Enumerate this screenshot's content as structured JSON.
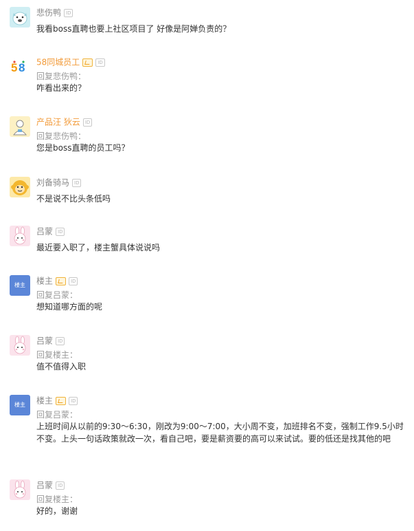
{
  "comments": [
    {
      "avatar": "bulldog-avatar",
      "name": "悲伤鸭",
      "name_color": "gray",
      "badges": [
        "ID"
      ],
      "reply_to": "",
      "text": "我看boss直聘也要上社区项目了 好像是阿婵负责的？"
    },
    {
      "avatar": "58-logo-avatar",
      "name": "58同城员工",
      "name_color": "orange",
      "badges": [
        "VIP",
        "ID"
      ],
      "reply_to": "回复悲伤鸭：",
      "text": "咋看出来的？"
    },
    {
      "avatar": "person-avatar",
      "name": "产品汪 狄云",
      "name_color": "orange",
      "badges": [
        "ID"
      ],
      "reply_to": "回复悲伤鸭：",
      "text": "您是boss直聘的员工吗？"
    },
    {
      "avatar": "monkey-avatar",
      "name": "刘备骑马",
      "name_color": "gray",
      "badges": [
        "ID"
      ],
      "reply_to": "",
      "text": "不是说不比头条低吗"
    },
    {
      "avatar": "rabbit-avatar",
      "name": "吕蒙",
      "name_color": "gray",
      "badges": [
        "ID"
      ],
      "reply_to": "",
      "text": "最近要入职了，楼主蟹具体说说吗"
    },
    {
      "avatar": "owner-avatar",
      "avatar_text": "楼主",
      "name": "楼主",
      "name_color": "gray",
      "badges": [
        "VIP",
        "ID"
      ],
      "reply_to": "回复吕蒙：",
      "text": "想知道哪方面的呢"
    },
    {
      "avatar": "rabbit-avatar",
      "name": "吕蒙",
      "name_color": "gray",
      "badges": [
        "ID"
      ],
      "reply_to": "回复楼主：",
      "text": "值不值得入职"
    },
    {
      "avatar": "owner-avatar",
      "avatar_text": "楼主",
      "name": "楼主",
      "name_color": "gray",
      "badges": [
        "VIP",
        "ID"
      ],
      "reply_to": "回复吕蒙：",
      "text": "上班时间从以前的9:30～6:30，刚改为9:00～7:00，大小周不变，加班排名不变，强制工作9.5小时不变。上头一句话政策就改一次，看自己吧，要是薪资要的高可以来试试。要的低还是找其他的吧"
    },
    {
      "avatar": "rabbit-avatar",
      "name": "吕蒙",
      "name_color": "gray",
      "badges": [
        "ID"
      ],
      "reply_to": "回复楼主：",
      "text": "好的，谢谢"
    }
  ],
  "colors": {
    "orange_name": "#f29a38",
    "gray_name": "#888888",
    "owner_avatar_bg": "#5b86d8"
  }
}
